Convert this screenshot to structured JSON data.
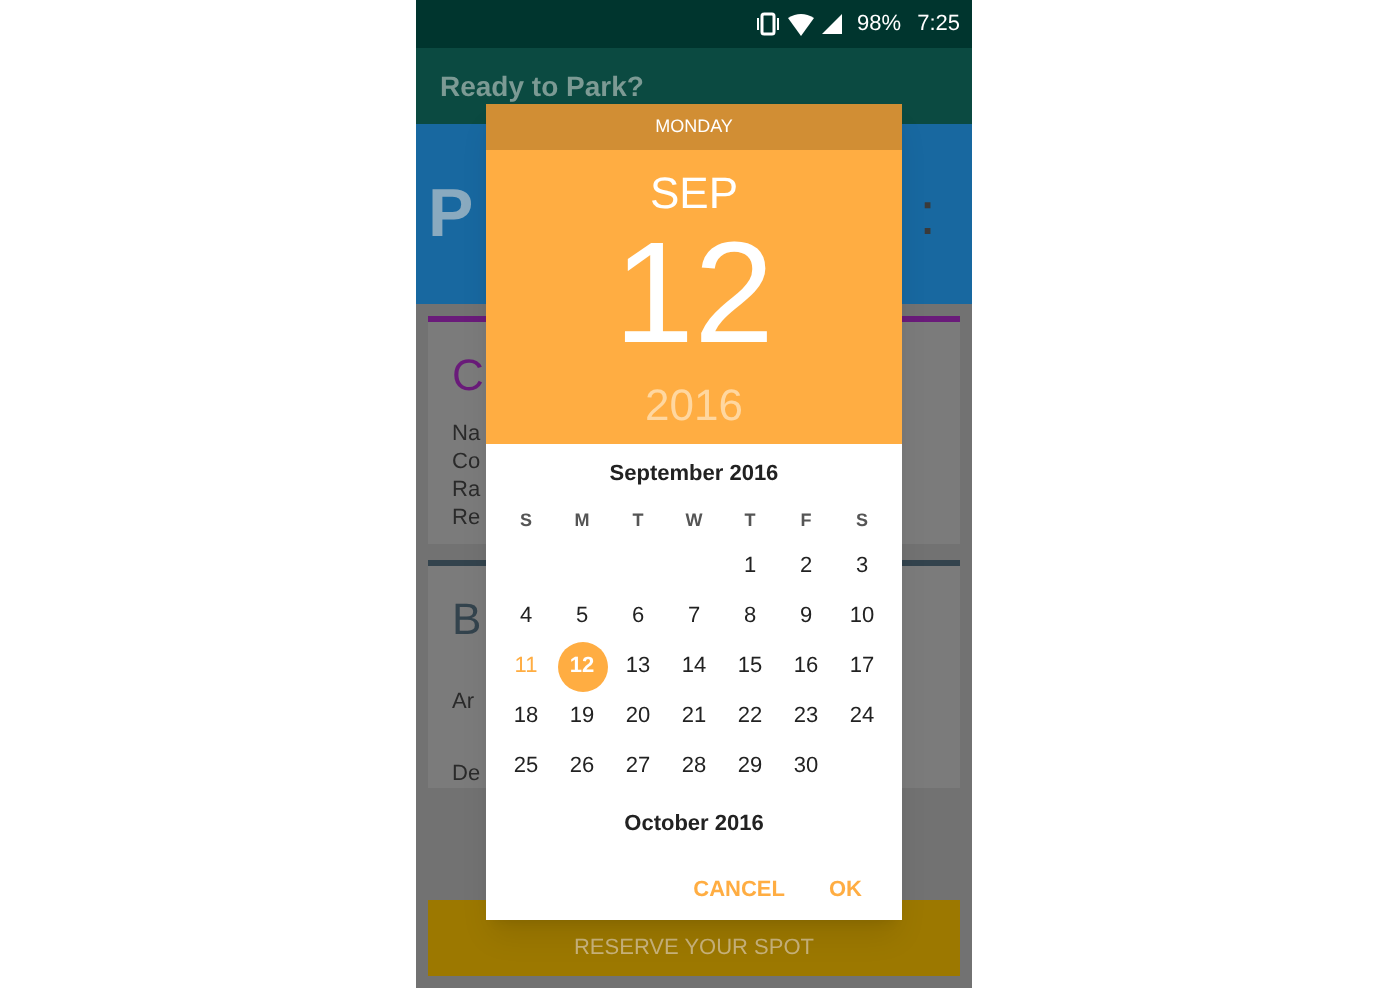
{
  "status_bar": {
    "battery": "98%",
    "time": "7:25"
  },
  "app_bar": {
    "title": "Ready to Park?"
  },
  "banner": {
    "text_left": "P",
    "text_right": ":"
  },
  "cards": [
    {
      "heading": "C",
      "color": "#6a1b7a",
      "lines": [
        "Na",
        "Co",
        "Ra",
        "Re"
      ]
    },
    {
      "heading": "B",
      "color": "#33434d",
      "lines": [
        "Ar",
        "De"
      ]
    }
  ],
  "reserve_button": "RESERVE YOUR SPOT",
  "date_picker": {
    "weekday": "MONDAY",
    "month": "SEP",
    "day": "12",
    "year": "2016",
    "month_title": "September 2016",
    "weekdays": [
      "S",
      "M",
      "T",
      "W",
      "T",
      "F",
      "S"
    ],
    "weeks": [
      [
        {
          "kind": "blank"
        },
        {
          "kind": "blank"
        },
        {
          "kind": "blank"
        },
        {
          "kind": "blank"
        },
        {
          "kind": "day",
          "label": "1",
          "selected": false,
          "today": false
        },
        {
          "kind": "day",
          "label": "2",
          "selected": false,
          "today": false
        },
        {
          "kind": "day",
          "label": "3",
          "selected": false,
          "today": false
        }
      ],
      [
        {
          "kind": "day",
          "label": "4",
          "selected": false,
          "today": false
        },
        {
          "kind": "day",
          "label": "5",
          "selected": false,
          "today": false
        },
        {
          "kind": "day",
          "label": "6",
          "selected": false,
          "today": false
        },
        {
          "kind": "day",
          "label": "7",
          "selected": false,
          "today": false
        },
        {
          "kind": "day",
          "label": "8",
          "selected": false,
          "today": false
        },
        {
          "kind": "day",
          "label": "9",
          "selected": false,
          "today": false
        },
        {
          "kind": "day",
          "label": "10",
          "selected": false,
          "today": false
        }
      ],
      [
        {
          "kind": "day",
          "label": "11",
          "selected": false,
          "today": true
        },
        {
          "kind": "day",
          "label": "12",
          "selected": true,
          "today": false
        },
        {
          "kind": "day",
          "label": "13",
          "selected": false,
          "today": false
        },
        {
          "kind": "day",
          "label": "14",
          "selected": false,
          "today": false
        },
        {
          "kind": "day",
          "label": "15",
          "selected": false,
          "today": false
        },
        {
          "kind": "day",
          "label": "16",
          "selected": false,
          "today": false
        },
        {
          "kind": "day",
          "label": "17",
          "selected": false,
          "today": false
        }
      ],
      [
        {
          "kind": "day",
          "label": "18",
          "selected": false,
          "today": false
        },
        {
          "kind": "day",
          "label": "19",
          "selected": false,
          "today": false
        },
        {
          "kind": "day",
          "label": "20",
          "selected": false,
          "today": false
        },
        {
          "kind": "day",
          "label": "21",
          "selected": false,
          "today": false
        },
        {
          "kind": "day",
          "label": "22",
          "selected": false,
          "today": false
        },
        {
          "kind": "day",
          "label": "23",
          "selected": false,
          "today": false
        },
        {
          "kind": "day",
          "label": "24",
          "selected": false,
          "today": false
        }
      ],
      [
        {
          "kind": "day",
          "label": "25",
          "selected": false,
          "today": false
        },
        {
          "kind": "day",
          "label": "26",
          "selected": false,
          "today": false
        },
        {
          "kind": "day",
          "label": "27",
          "selected": false,
          "today": false
        },
        {
          "kind": "day",
          "label": "28",
          "selected": false,
          "today": false
        },
        {
          "kind": "day",
          "label": "29",
          "selected": false,
          "today": false
        },
        {
          "kind": "day",
          "label": "30",
          "selected": false,
          "today": false
        },
        {
          "kind": "blank"
        }
      ]
    ],
    "next_month_title": "October 2016",
    "buttons": [
      "CANCEL",
      "OK"
    ]
  }
}
